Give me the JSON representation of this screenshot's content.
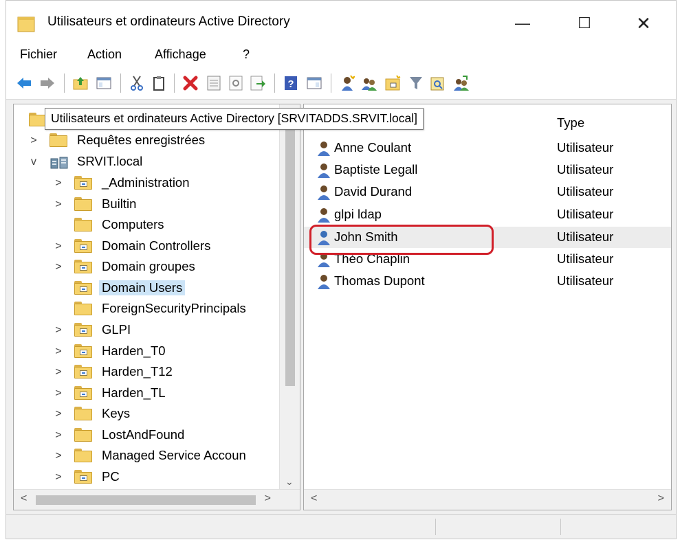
{
  "window": {
    "title": "Utilisateurs et ordinateurs Active Directory",
    "minimize_glyph": "—",
    "maximize_glyph": "☐",
    "close_glyph": "✕"
  },
  "menu": {
    "items": [
      "Fichier",
      "Action",
      "Affichage",
      "?"
    ]
  },
  "toolbar": {
    "icons": [
      "back-arrow-icon",
      "forward-arrow-icon",
      "up-folder-icon",
      "show-console-tree-icon",
      "cut-icon",
      "copy-icon",
      "delete-icon",
      "properties-icon",
      "refresh-icon",
      "export-list-icon",
      "help-icon",
      "show-action-pane-icon",
      "new-user-icon",
      "new-group-icon",
      "new-ou-icon",
      "filter-icon",
      "find-icon",
      "add-to-group-icon"
    ]
  },
  "tree": {
    "root_tooltip": "Utilisateurs et ordinateurs Active Directory [SRVITADDS.SRVIT.local]",
    "items": [
      {
        "label": "Requêtes enregistrées",
        "expand": ">"
      },
      {
        "label": "SRVIT.local",
        "expand": "v"
      },
      {
        "label": "_Administration",
        "expand": ">"
      },
      {
        "label": "Builtin",
        "expand": ">"
      },
      {
        "label": "Computers",
        "expand": ""
      },
      {
        "label": "Domain Controllers",
        "expand": ">"
      },
      {
        "label": "Domain groupes",
        "expand": ">"
      },
      {
        "label": "Domain Users",
        "expand": ""
      },
      {
        "label": "ForeignSecurityPrincipals",
        "expand": ""
      },
      {
        "label": "GLPI",
        "expand": ">"
      },
      {
        "label": "Harden_T0",
        "expand": ">"
      },
      {
        "label": "Harden_T12",
        "expand": ">"
      },
      {
        "label": "Harden_TL",
        "expand": ">"
      },
      {
        "label": "Keys",
        "expand": ">"
      },
      {
        "label": "LostAndFound",
        "expand": ">"
      },
      {
        "label": "Managed Service Accoun",
        "expand": ">"
      },
      {
        "label": "PC",
        "expand": ">"
      }
    ],
    "selected": "Domain Users"
  },
  "list": {
    "column_type": "Type",
    "rows": [
      {
        "name": "Anne Coulant",
        "type": "Utilisateur"
      },
      {
        "name": "Baptiste Legall",
        "type": "Utilisateur"
      },
      {
        "name": "David Durand",
        "type": "Utilisateur"
      },
      {
        "name": "glpi ldap",
        "type": "Utilisateur"
      },
      {
        "name": "John Smith",
        "type": "Utilisateur"
      },
      {
        "name": "Théo Chaplin",
        "type": "Utilisateur"
      },
      {
        "name": "Thomas Dupont",
        "type": "Utilisateur"
      }
    ],
    "highlighted": "John Smith"
  },
  "scroll": {
    "left": "<",
    "right": ">",
    "down": "⌄"
  },
  "colors": {
    "highlight_ring": "#d1202a",
    "selection": "#cce4f7",
    "folder": "#f6d36b"
  }
}
